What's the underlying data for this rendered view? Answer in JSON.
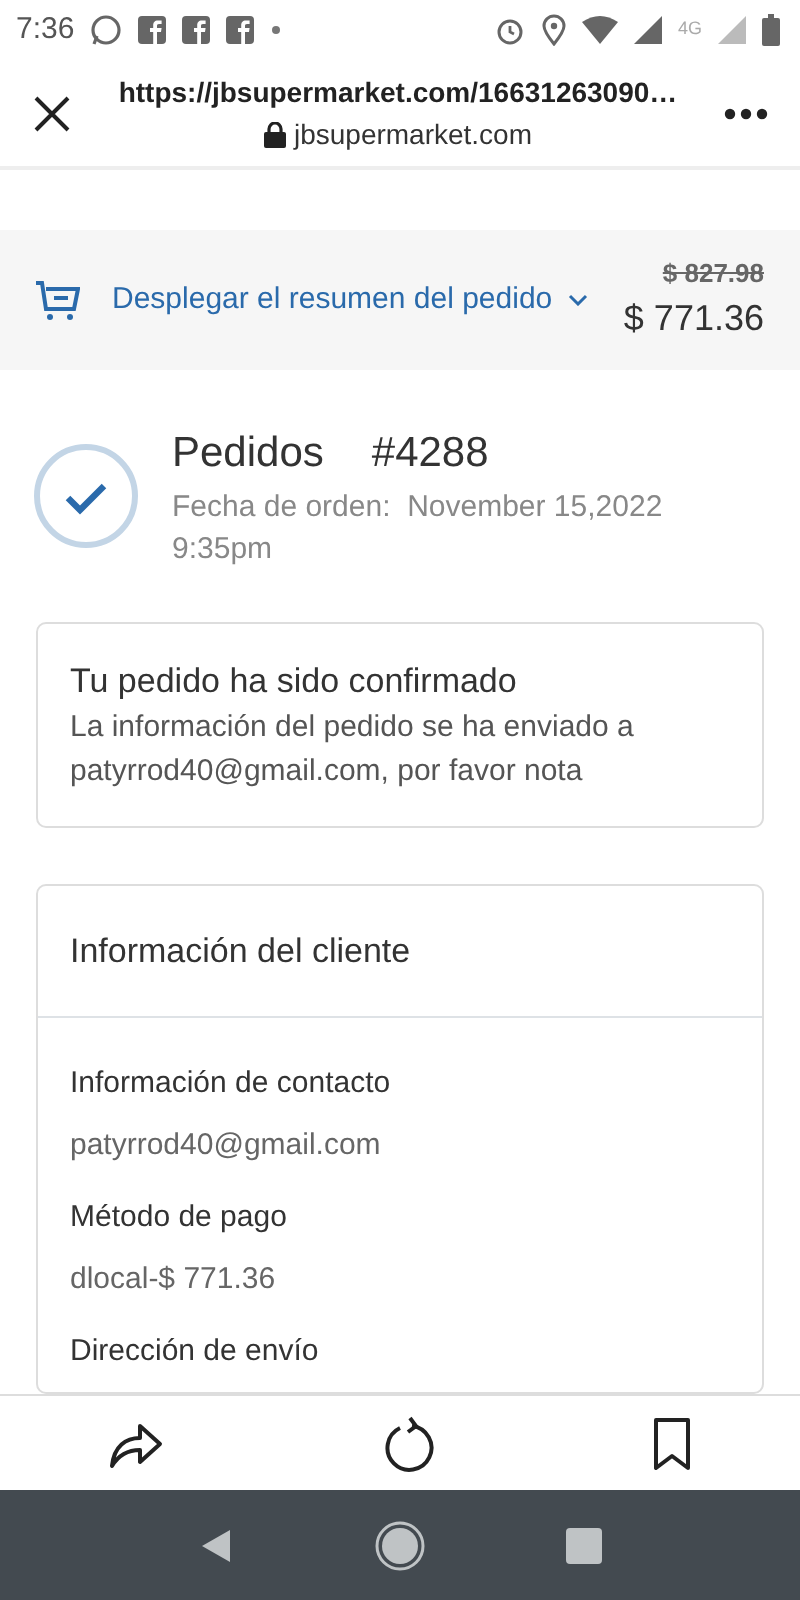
{
  "status_bar": {
    "time": "7:36",
    "network": "4G"
  },
  "browser": {
    "url": "https://jbsupermarket.com/16631263090…",
    "domain": "jbsupermarket.com"
  },
  "summary": {
    "toggle": "Desplegar el resumen del pedido",
    "original_price": "$ 827.98",
    "price": "$ 771.36"
  },
  "order": {
    "title": "Pedidos",
    "number": "#4288",
    "date_label": "Fecha de orden:",
    "date": "November 15,2022 9:35pm"
  },
  "confirmation": {
    "title": "Tu pedido ha sido confirmado",
    "message": "La información del pedido se ha enviado a patyrrod40@gmail.com, por favor nota"
  },
  "customer": {
    "title": "Información del cliente",
    "sections": [
      {
        "label": "Información de contacto",
        "value": "patyrrod40@gmail.com"
      },
      {
        "label": "Método de pago",
        "value": "dlocal-$ 771.36"
      },
      {
        "label": "Dirección de envío"
      }
    ]
  }
}
